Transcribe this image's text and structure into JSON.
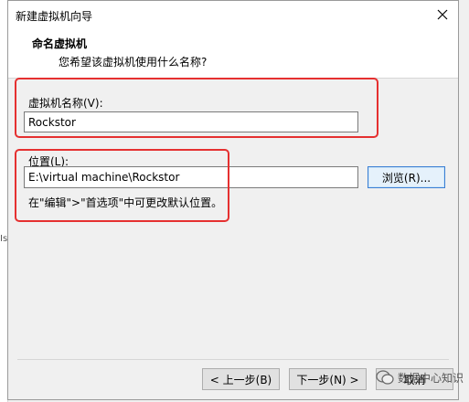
{
  "background": {
    "partial_char": "Is"
  },
  "window": {
    "title": "新建虚拟机向导"
  },
  "header": {
    "title": "命名虚拟机",
    "subtitle": "您希望该虚拟机使用什么名称?"
  },
  "form": {
    "name_label": "虚拟机名称(V):",
    "name_value": "Rockstor",
    "location_label": "位置(L):",
    "location_value": "E:\\virtual machine\\Rockstor",
    "browse_label": "浏览(R)...",
    "hint": "在\"编辑\">\"首选项\"中可更改默认位置。"
  },
  "footer": {
    "back_label": "< 上一步(B)",
    "next_label": "下一步(N) >",
    "cancel_label": "取消"
  },
  "watermark": {
    "text": "数据中心知识"
  },
  "colors": {
    "highlight_box": "#e53030",
    "accent_button_border": "#3b7fd4"
  }
}
